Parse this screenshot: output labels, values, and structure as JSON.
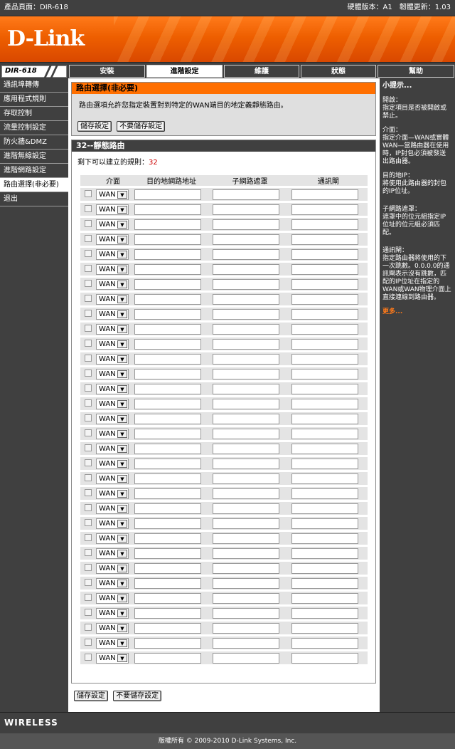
{
  "topbar": {
    "product": "產品頁面：DIR-618",
    "version": "硬體版本：A1　韌體更新：1.03"
  },
  "brand": {
    "logo": "D-Link",
    "wireless": "WIRELESS"
  },
  "model_label": "DIR-618",
  "tabs": [
    {
      "label": "安裝"
    },
    {
      "label": "進階設定"
    },
    {
      "label": "維護"
    },
    {
      "label": "狀態"
    },
    {
      "label": "幫助"
    }
  ],
  "sidebar": {
    "items": [
      {
        "label": "通訊埠轉傳"
      },
      {
        "label": "應用程式規則"
      },
      {
        "label": "存取控制"
      },
      {
        "label": "流量控制設定"
      },
      {
        "label": "防火牆&DMZ"
      },
      {
        "label": "進階無線設定"
      },
      {
        "label": "進階網路設定"
      },
      {
        "label": "路由選擇(非必要)"
      },
      {
        "label": "退出"
      }
    ]
  },
  "routing": {
    "title": "路由選擇(非必要)",
    "description": "路由選項允許您指定裝置對到特定的WAN端目的地定義靜態路由。",
    "save_label": "儲存設定",
    "nosave_label": "不要儲存設定"
  },
  "static": {
    "title": "32--靜態路由",
    "remaining_label": "剩下可以建立的規則：",
    "remaining_count": "32",
    "headers": {
      "interface": "介面",
      "dest": "目的地網路地址",
      "mask": "子網路遮罩",
      "gateway": "通訊閘"
    },
    "wan_option": "WAN",
    "row_count": 32
  },
  "hints": {
    "title": "小提示...",
    "enable": "開啟：\n指定項目是否被開啟或禁止。",
    "interface": "介面：\n指定介面—WAN或實體WAN—當路由器在使用時，IP封包必須被發送出路由器。",
    "dest": "目的地IP：\n將使用此路由器的封包的IP位址。",
    "mask": "子網路遮罩：\n遮罩中的位元組指定IP位址的位元組必須匹配。",
    "gateway": "通訊閘：\n指定路由器將使用的下一次跳數。0.0.0.0的通訊閘表示沒有跳數，匹配的IP位址在指定的WAN或WAN物理介面上直接連線到路由器。",
    "more": "更多..."
  },
  "footer": "版權所有 © 2009-2010 D-Link Systems, Inc."
}
